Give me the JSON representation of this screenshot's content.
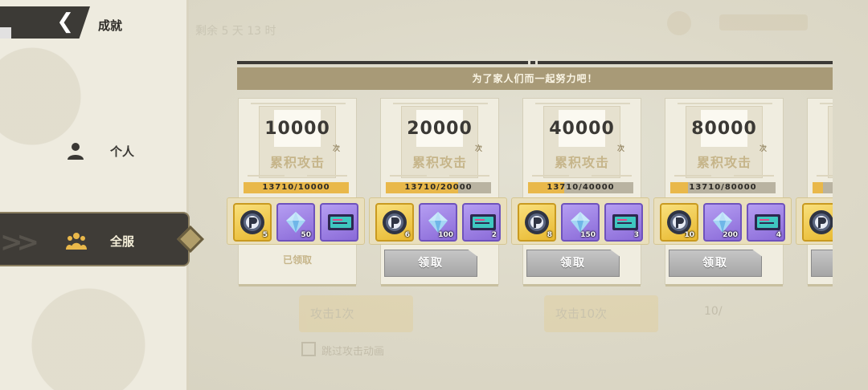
{
  "background": {
    "ghost_timer_text": "剩余 5 天 13 时",
    "ghost_buttons": [
      "攻击1次",
      "攻击10次"
    ],
    "ghost_cost": "10/",
    "ghost_checkbox_label": "跳过攻击动画"
  },
  "sidebar": {
    "back_icon": "chevron-left-icon",
    "title": "成就",
    "items": [
      {
        "label": "个人",
        "icon": "person-icon",
        "active": false
      },
      {
        "label": "全服",
        "icon": "group-icon",
        "active": true
      }
    ]
  },
  "main": {
    "banner": "为了家人们而一起努力吧！",
    "caption": "累积攻击",
    "unit": "次",
    "claimed_label": "已领取",
    "claim_label": "领取",
    "cards": [
      {
        "target": "10000",
        "progress_text": "13710/10000",
        "progress": 1.0,
        "status": "claimed",
        "rewards": [
          {
            "icon": "coin-icon",
            "count": "5"
          },
          {
            "icon": "crystal-icon",
            "count": "50"
          },
          {
            "icon": "ticket-icon",
            "count": ""
          }
        ]
      },
      {
        "target": "20000",
        "progress_text": "13710/20000",
        "progress": 0.6855,
        "status": "claimable",
        "rewards": [
          {
            "icon": "coin-icon",
            "count": "6"
          },
          {
            "icon": "crystal-icon",
            "count": "100"
          },
          {
            "icon": "ticket-icon",
            "count": "2"
          }
        ]
      },
      {
        "target": "40000",
        "progress_text": "13710/40000",
        "progress": 0.3428,
        "status": "claimable",
        "rewards": [
          {
            "icon": "coin-icon",
            "count": "8"
          },
          {
            "icon": "crystal-icon",
            "count": "150"
          },
          {
            "icon": "ticket-icon",
            "count": "3"
          }
        ]
      },
      {
        "target": "80000",
        "progress_text": "13710/80000",
        "progress": 0.1714,
        "status": "claimable",
        "rewards": [
          {
            "icon": "coin-icon",
            "count": "10"
          },
          {
            "icon": "crystal-icon",
            "count": "200"
          },
          {
            "icon": "ticket-icon",
            "count": "4"
          }
        ]
      },
      {
        "target": "",
        "progress_text": "13",
        "progress": 0.1,
        "status": "claimable",
        "rewards": [
          {
            "icon": "coin-icon",
            "count": ""
          }
        ]
      }
    ]
  }
}
